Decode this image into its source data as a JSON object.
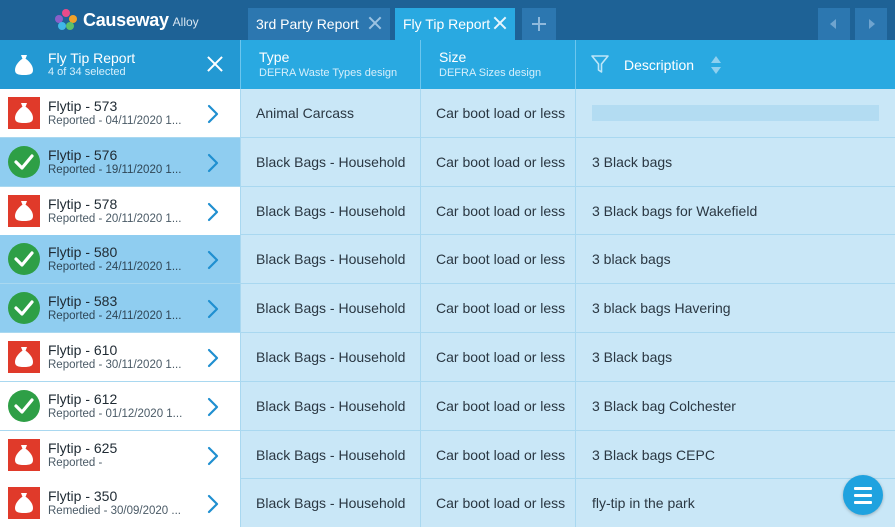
{
  "app": {
    "brand": "Causeway",
    "product": "Alloy",
    "colors": {
      "topbar": "#1e6296",
      "accent": "#29a9e1",
      "row_bg": "#c9e7f7",
      "selected": "#8fcdf0",
      "status_red": "#e03a2a",
      "status_green": "#2e9f46"
    }
  },
  "tabs": [
    {
      "label": "3rd Party Report",
      "active": false,
      "close_icon": "close-icon"
    },
    {
      "label": "Fly Tip Report",
      "active": true,
      "close_icon": "close-icon"
    }
  ],
  "toolbar": {
    "add_icon": "plus-icon",
    "prev_icon": "chevron-left-icon",
    "next_icon": "chevron-right-icon"
  },
  "panel": {
    "icon": "bag-icon",
    "title": "Fly Tip Report",
    "selection": "4 of 34 selected",
    "close_icon": "close-icon"
  },
  "columns": [
    {
      "title": "Type",
      "subtitle": "DEFRA Waste Types design"
    },
    {
      "title": "Size",
      "subtitle": "DEFRA Sizes design"
    },
    {
      "title": "Description",
      "filter_icon": "filter-icon",
      "sort_icon": "sort-icon"
    }
  ],
  "rows": [
    {
      "title": "Flytip - 573",
      "sub": "Reported - 04/11/2020 1...",
      "status": "reported",
      "selected": false,
      "type": "Animal Carcass",
      "size": "Car boot load or less",
      "description": ""
    },
    {
      "title": "Flytip - 576",
      "sub": "Reported - 19/11/2020 1...",
      "status": "done",
      "selected": true,
      "type": "Black Bags - Household",
      "size": "Car boot load or less",
      "description": "3 Black bags"
    },
    {
      "title": "Flytip - 578",
      "sub": "Reported - 20/11/2020 1...",
      "status": "reported",
      "selected": false,
      "type": "Black Bags - Household",
      "size": "Car boot load or less",
      "description": "3 Black bags for Wakefield"
    },
    {
      "title": "Flytip - 580",
      "sub": "Reported - 24/11/2020 1...",
      "status": "done",
      "selected": true,
      "type": "Black Bags - Household",
      "size": "Car boot load or less",
      "description": "3 black bags"
    },
    {
      "title": "Flytip - 583",
      "sub": "Reported - 24/11/2020 1...",
      "status": "done",
      "selected": true,
      "type": "Black Bags - Household",
      "size": "Car boot load or less",
      "description": "3 black bags Havering"
    },
    {
      "title": "Flytip - 610",
      "sub": "Reported - 30/11/2020 1...",
      "status": "reported",
      "selected": false,
      "type": "Black Bags - Household",
      "size": "Car boot load or less",
      "description": "3 Black bags"
    },
    {
      "title": "Flytip - 612",
      "sub": "Reported - 01/12/2020 1...",
      "status": "done",
      "selected": false,
      "type": "Black Bags - Household",
      "size": "Car boot load or less",
      "description": "3 Black bag Colchester"
    },
    {
      "title": "Flytip - 625",
      "sub": "Reported -",
      "status": "reported",
      "selected": false,
      "type": "Black Bags - Household",
      "size": "Car boot load or less",
      "description": "3 Black bags CEPC"
    },
    {
      "title": "Flytip - 350",
      "sub": "Remedied - 30/09/2020 ...",
      "status": "reported",
      "selected": false,
      "type": "Black Bags - Household",
      "size": "Car boot load or less",
      "description": "fly-tip in the park"
    }
  ],
  "fab": {
    "icon": "menu-icon"
  }
}
